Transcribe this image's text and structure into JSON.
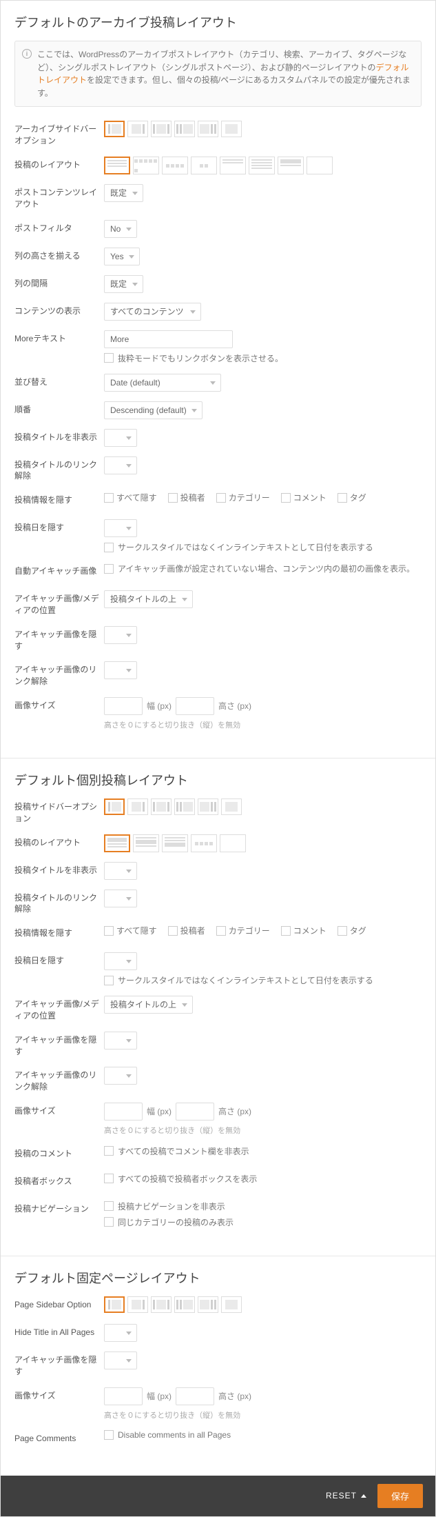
{
  "archive": {
    "title": "デフォルトのアーカイブ投稿レイアウト",
    "notice_pre": "ここでは、WordPressのアーカイブポストレイアウト（カテゴリ、検索、アーカイブ、タグページなど）、シングルポストレイアウト（シングルポストページ）、および静的ページレイアウトの",
    "notice_strong": "デフォルトレイアウト",
    "notice_post": "を設定できます。但し、個々の投稿/ページにあるカスタムパネルでの設定が優先されます。",
    "rows": {
      "sidebar_opt": "アーカイブサイドバーオプション",
      "post_layout": "投稿のレイアウト",
      "post_content_layout": "ポストコンテンツレイアウト",
      "post_filter": "ポストフィルタ",
      "equal_height": "列の高さを揃える",
      "col_gap": "列の間隔",
      "content_display": "コンテンツの表示",
      "more_text": "Moreテキスト",
      "sort": "並び替え",
      "order": "順番",
      "hide_title": "投稿タイトルを非表示",
      "unlink_title": "投稿タイトルのリンク解除",
      "hide_meta": "投稿情報を隠す",
      "hide_date": "投稿日を隠す",
      "auto_featured": "自動アイキャッチ画像",
      "media_pos": "アイキャッチ画像/メディアの位置",
      "hide_featured": "アイキャッチ画像を隠す",
      "unlink_featured": "アイキャッチ画像のリンク解除",
      "image_size": "画像サイズ"
    },
    "values": {
      "post_content_layout": "既定",
      "post_filter": "No",
      "equal_height": "Yes",
      "col_gap": "既定",
      "content_display": "すべてのコンテンツ",
      "more_text": "More",
      "more_text_chk": "抜粋モードでもリンクボタンを表示させる。",
      "sort": "Date (default)",
      "order": "Descending (default)",
      "meta_all": "すべて隠す",
      "meta_author": "投稿者",
      "meta_category": "カテゴリー",
      "meta_comment": "コメント",
      "meta_tag": "タグ",
      "date_inline": "サークルスタイルではなくインラインテキストとして日付を表示する",
      "auto_featured_chk": "アイキャッチ画像が設定されていない場合、コンテンツ内の最初の画像を表示。",
      "media_pos": "投稿タイトルの上",
      "width_lbl": "幅 (px)",
      "height_lbl": "高さ (px)",
      "size_hint": "高さを０にすると切り抜き（縦）を無効"
    }
  },
  "single": {
    "title": "デフォルト個別投稿レイアウト",
    "rows": {
      "sidebar_opt": "投稿サイドバーオプション",
      "post_layout": "投稿のレイアウト",
      "hide_title": "投稿タイトルを非表示",
      "unlink_title": "投稿タイトルのリンク解除",
      "hide_meta": "投稿情報を隠す",
      "hide_date": "投稿日を隠す",
      "media_pos": "アイキャッチ画像/メディアの位置",
      "hide_featured": "アイキャッチ画像を隠す",
      "unlink_featured": "アイキャッチ画像のリンク解除",
      "image_size": "画像サイズ",
      "comments": "投稿のコメント",
      "author_box": "投稿者ボックス",
      "post_nav": "投稿ナビゲーション"
    },
    "values": {
      "media_pos": "投稿タイトルの上",
      "comments_chk": "すべての投稿でコメント欄を非表示",
      "author_box_chk": "すべての投稿で投稿者ボックスを表示",
      "post_nav_chk1": "投稿ナビゲーションを非表示",
      "post_nav_chk2": "同じカテゴリーの投稿のみ表示"
    }
  },
  "page": {
    "title": "デフォルト固定ページレイアウト",
    "rows": {
      "sidebar_opt": "Page Sidebar Option",
      "hide_title": "Hide Title in All Pages",
      "hide_featured": "アイキャッチ画像を隠す",
      "image_size": "画像サイズ",
      "comments": "Page Comments"
    },
    "values": {
      "comments_chk": "Disable comments in all Pages"
    }
  },
  "footer": {
    "reset": "RESET",
    "save": "保存"
  }
}
